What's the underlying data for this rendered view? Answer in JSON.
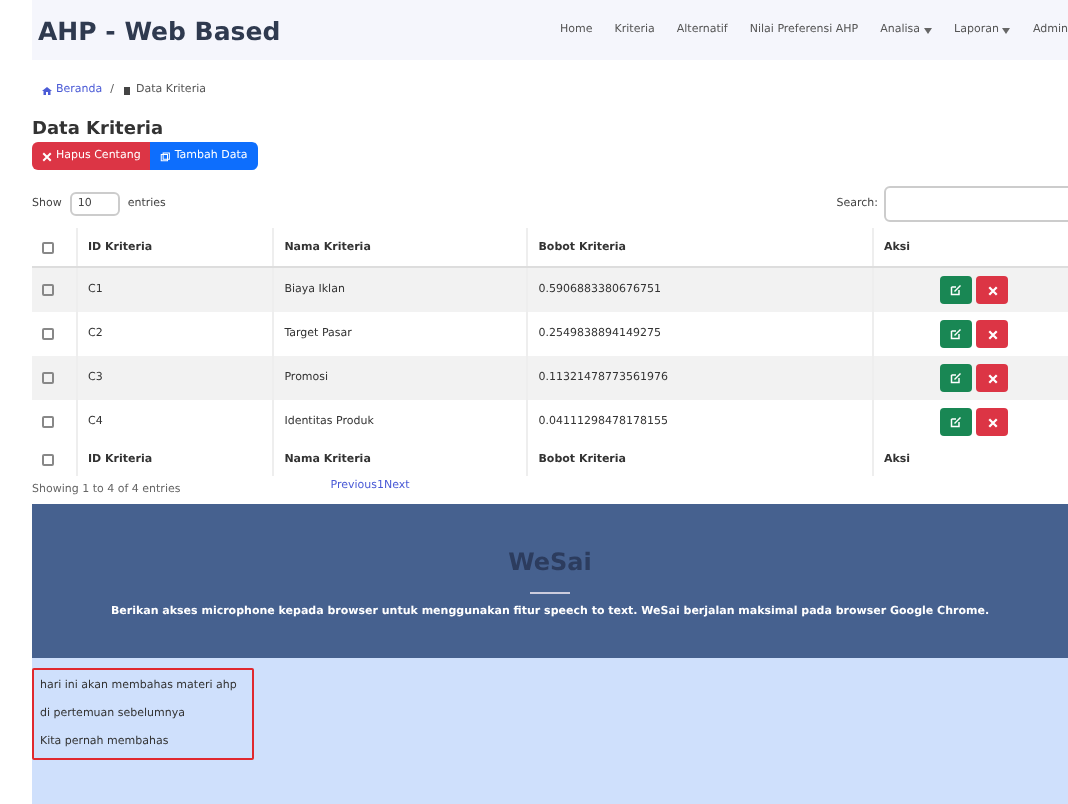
{
  "navbar": {
    "brand": "AHP - Web Based",
    "items": [
      {
        "label": "Home",
        "dropdown": false
      },
      {
        "label": "Kriteria",
        "dropdown": false
      },
      {
        "label": "Alternatif",
        "dropdown": false
      },
      {
        "label": "Nilai Preferensi AHP",
        "dropdown": false
      },
      {
        "label": "Analisa",
        "dropdown": true
      },
      {
        "label": "Laporan",
        "dropdown": true
      },
      {
        "label": "Admin",
        "dropdown": false
      }
    ]
  },
  "breadcrumb_separator": "/",
  "breadcrumb": [
    {
      "label": "Beranda",
      "link": true
    },
    {
      "label": "Data Kriteria",
      "link": false
    }
  ],
  "page_title": "Data Kriteria",
  "buttons": [
    {
      "label": "Hapus Centang",
      "kind": "danger"
    },
    {
      "label": "Tambah Data",
      "kind": "primary"
    }
  ],
  "length": {
    "before": "Show",
    "value": "10",
    "after": "entries"
  },
  "search": {
    "label": "Search:"
  },
  "table": {
    "header_checked": false,
    "columns": [
      "ID Kriteria",
      "Nama Kriteria",
      "Bobot Kriteria",
      "Aksi"
    ],
    "rows": [
      {
        "checked": false,
        "cells": [
          "C1",
          "Biaya Iklan",
          "0.5906883380676751"
        ]
      },
      {
        "checked": false,
        "cells": [
          "C2",
          "Target Pasar",
          "0.2549838894149275"
        ]
      },
      {
        "checked": false,
        "cells": [
          "C3",
          "Promosi",
          "0.11321478773561976"
        ]
      },
      {
        "checked": false,
        "cells": [
          "C4",
          "Identitas Produk",
          "0.04111298478178155"
        ]
      }
    ],
    "footer_checked": false,
    "footer": [
      "ID Kriteria",
      "Nama Kriteria",
      "Bobot Kriteria",
      "Aksi"
    ]
  },
  "info": "Showing 1 to 4 of 4 entries",
  "pagination": [
    "Previous",
    "1",
    "Next"
  ],
  "wesai": {
    "title": "WeSai",
    "description": "Berikan akses microphone kepada browser untuk menggunakan fitur speech to text. WeSai berjalan maksimal pada browser Google Chrome.",
    "transcript": [
      "hari ini akan membahas materi ahp",
      "di pertemuan sebelumnya",
      "Kita pernah membahas"
    ]
  }
}
